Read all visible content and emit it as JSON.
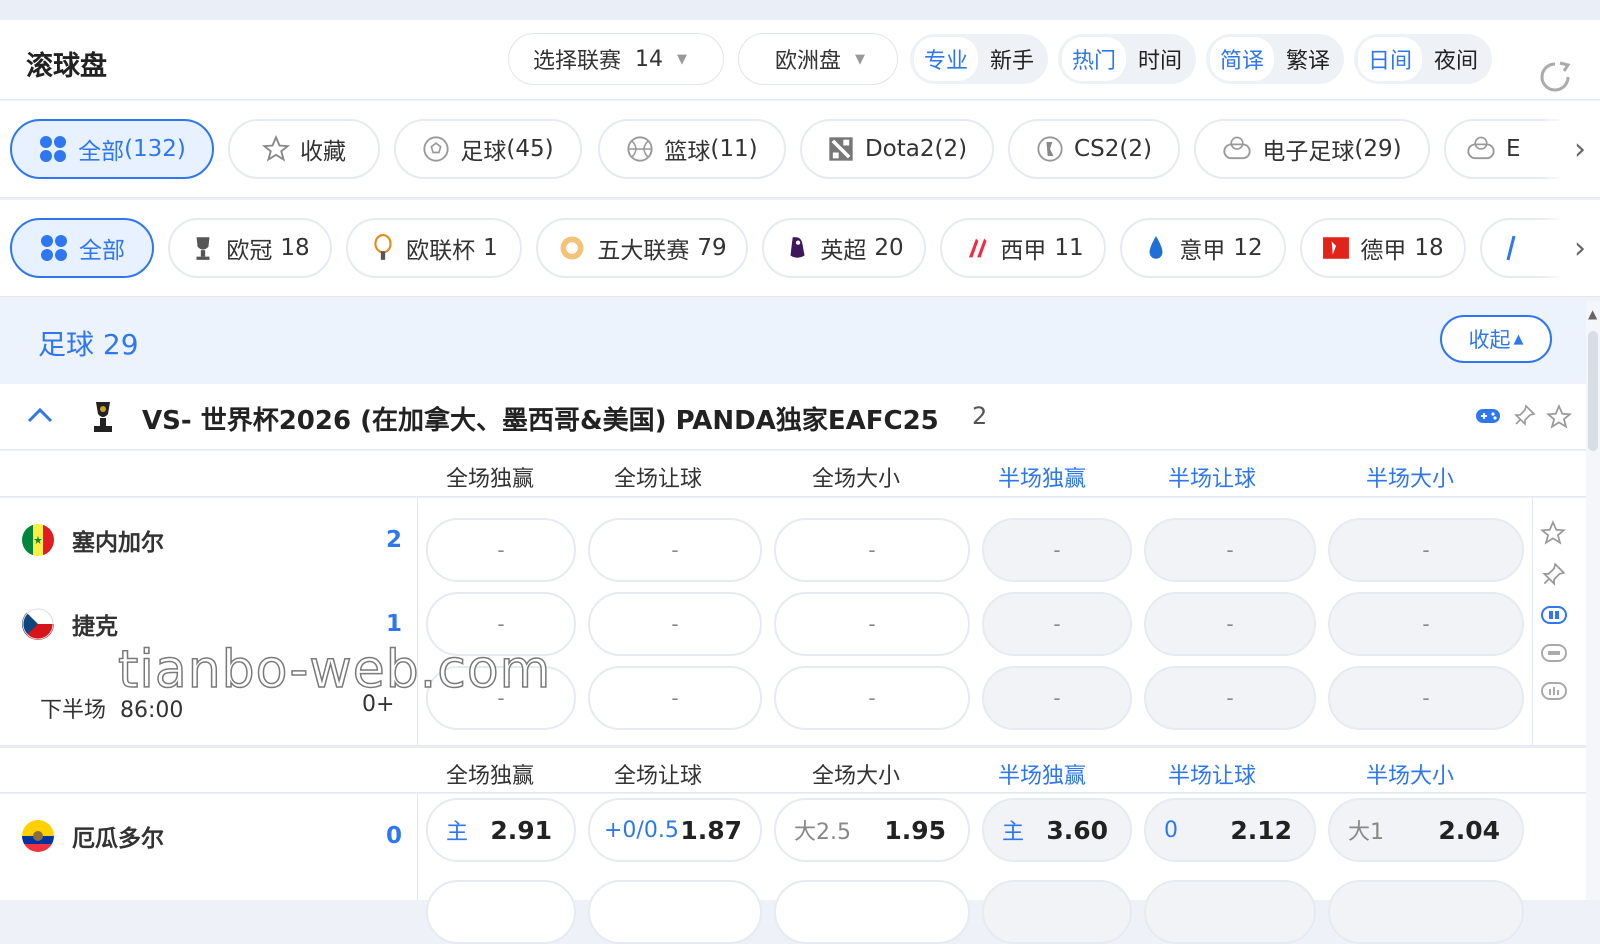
{
  "header": {
    "title": "滚球盘",
    "league_select": {
      "label": "选择联赛",
      "count": "14"
    },
    "odds_format": "欧洲盘",
    "toggles": [
      {
        "on": "专业",
        "off": "新手"
      },
      {
        "on": "热门",
        "off": "时间"
      },
      {
        "on": "简译",
        "off": "繁译"
      },
      {
        "on": "日间",
        "off": "夜间"
      }
    ],
    "refresh_icon": "refresh-icon"
  },
  "categories": [
    {
      "label": "全部",
      "count": "(132)",
      "icon": "grid-icon"
    },
    {
      "label": "收藏",
      "count": "",
      "icon": "star-icon"
    },
    {
      "label": "足球",
      "count": "(45)",
      "icon": "soccer-ball-icon"
    },
    {
      "label": "篮球",
      "count": "(11)",
      "icon": "basketball-icon"
    },
    {
      "label": "Dota2",
      "count": "(2)",
      "icon": "dota2-icon"
    },
    {
      "label": "CS2",
      "count": "(2)",
      "icon": "cs2-icon"
    },
    {
      "label": "电子足球",
      "count": "(29)",
      "icon": "esoccer-icon"
    },
    {
      "label": "E",
      "count": "",
      "icon": "controller-icon"
    }
  ],
  "leagues": [
    {
      "label": "全部",
      "count": "",
      "icon": "grid-icon"
    },
    {
      "label": "欧冠",
      "count": "18",
      "icon": "ucl-trophy-icon"
    },
    {
      "label": "欧联杯",
      "count": "1",
      "icon": "europa-trophy-icon"
    },
    {
      "label": "五大联赛",
      "count": "79",
      "icon": "five-leagues-icon"
    },
    {
      "label": "英超",
      "count": "20",
      "icon": "premier-league-icon"
    },
    {
      "label": "西甲",
      "count": "11",
      "icon": "laliga-icon"
    },
    {
      "label": "意甲",
      "count": "12",
      "icon": "serie-a-icon"
    },
    {
      "label": "德甲",
      "count": "18",
      "icon": "bundesliga-icon"
    }
  ],
  "sport_section": {
    "title": "足球 29",
    "collapse": "收起"
  },
  "league_header": {
    "name": "VS- 世界杯2026 (在加拿大、墨西哥&美国) PANDA独家EAFC25",
    "count": "2"
  },
  "columns": [
    "全场独赢",
    "全场让球",
    "全场大小",
    "半场独赢",
    "半场让球",
    "半场大小"
  ],
  "match1": {
    "home": {
      "name": "塞内加尔",
      "score": "2"
    },
    "away": {
      "name": "捷克",
      "score": "1"
    },
    "period": "下半场",
    "time": "86:00",
    "handicap": "0+",
    "empty_odd": "-"
  },
  "match2": {
    "home": {
      "name": "厄瓜多尔",
      "score": "0"
    },
    "odds": [
      {
        "label": "主",
        "value": "2.91"
      },
      {
        "label": "+0/0.5",
        "value": "1.87"
      },
      {
        "label": "大2.5",
        "value": "1.95"
      },
      {
        "label": "主",
        "value": "3.60"
      },
      {
        "label": "0",
        "value": "2.12"
      },
      {
        "label": "大1",
        "value": "2.04"
      }
    ]
  },
  "watermark": "tianbo-web.com",
  "colors": {
    "accent": "#2e77f0",
    "section_bg": "#edf3fd",
    "border": "#e6eaf1"
  }
}
